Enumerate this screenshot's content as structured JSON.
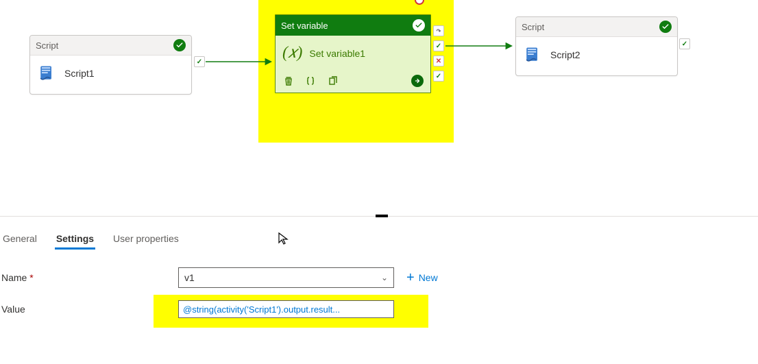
{
  "nodes": {
    "script1": {
      "type_label": "Script",
      "name": "Script1"
    },
    "setvar": {
      "type_label": "Set variable",
      "name": "Set variable1"
    },
    "script2": {
      "type_label": "Script",
      "name": "Script2"
    }
  },
  "tabs": {
    "general_label": "General",
    "settings_label": "Settings",
    "userprops_label": "User properties"
  },
  "form": {
    "name_label": "Name",
    "name_required_mark": "*",
    "name_value": "v1",
    "value_label": "Value",
    "value_expression": "@string(activity('Script1').output.result...",
    "new_label": "New"
  },
  "colors": {
    "accent_blue": "#0078d4",
    "success_green": "#107c10",
    "highlight": "#ffff00"
  }
}
